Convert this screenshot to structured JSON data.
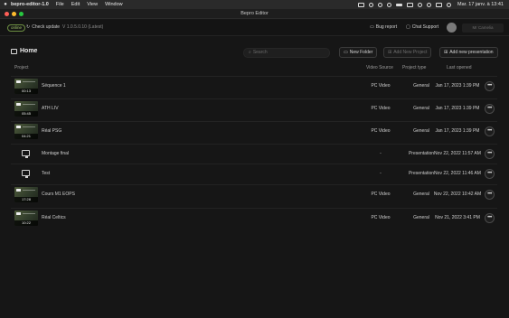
{
  "menubar": {
    "app_name": "bepro-editor-1.0",
    "items": [
      "File",
      "Edit",
      "View",
      "Window"
    ],
    "clock": "Mar. 17 janv. à 13:41"
  },
  "window": {
    "title": "Bepro Editor"
  },
  "topbar": {
    "status_badge": "online",
    "check_update": "Check update",
    "version": "V 1.0.5.0.10 (Latest)",
    "bug_report": "Bug report",
    "chat_support": "Chat Support",
    "username": "Mr Camelia"
  },
  "header": {
    "title": "Home",
    "search_placeholder": "Search",
    "new_folder": "New Folder",
    "add_new_project": "Add New Project",
    "add_new_presentation": "Add new presentation"
  },
  "table": {
    "columns": {
      "project": "Project",
      "video_source": "Video Source",
      "project_type": "Project type",
      "last_opened": "Last opened"
    },
    "rows": [
      {
        "name": "Séquence 1",
        "kind": "video",
        "duration": "00:13",
        "source": "PC Video",
        "type": "General",
        "opened": "Jan 17, 2023 1:39 PM"
      },
      {
        "name": "ATH LIV",
        "kind": "video",
        "duration": "05:45",
        "source": "PC Video",
        "type": "General",
        "opened": "Jan 17, 2023 1:39 PM"
      },
      {
        "name": "Réal PSG",
        "kind": "video",
        "duration": "04:21",
        "source": "PC Video",
        "type": "General",
        "opened": "Jan 17, 2023 1:39 PM"
      },
      {
        "name": "Montage final",
        "kind": "presentation",
        "duration": "",
        "source": "-",
        "type": "Presentation",
        "opened": "Nov 22, 2022 11:57 AM"
      },
      {
        "name": "Test",
        "kind": "presentation",
        "duration": "",
        "source": "-",
        "type": "Presentation",
        "opened": "Nov 22, 2022 11:46 AM"
      },
      {
        "name": "Cours M1 EOPS",
        "kind": "video",
        "duration": "17:28",
        "source": "PC Video",
        "type": "General",
        "opened": "Nov 22, 2022 10:42 AM"
      },
      {
        "name": "Réal Celtics",
        "kind": "video",
        "duration": "10:22",
        "source": "PC Video",
        "type": "General",
        "opened": "Nov 21, 2022 3:41 PM"
      }
    ],
    "more_label": "•••"
  },
  "colors": {
    "background": "#161616",
    "online_green": "#9fc46a",
    "traffic_red": "#ff5f57",
    "traffic_yellow": "#febc2e",
    "traffic_green": "#28c840"
  }
}
